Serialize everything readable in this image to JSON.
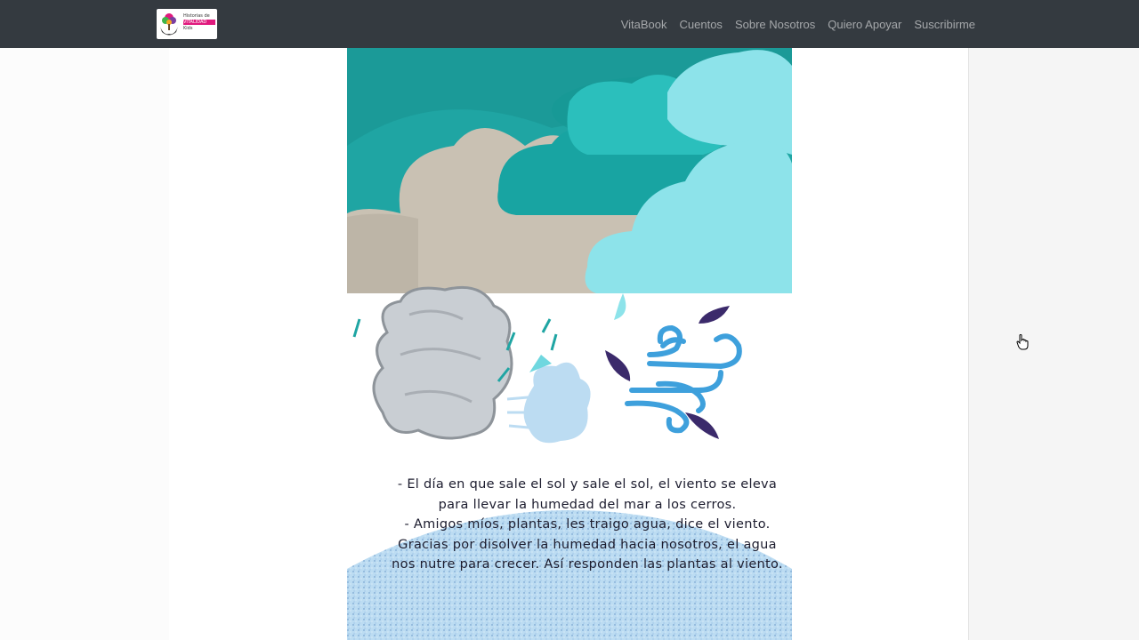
{
  "navbar": {
    "brand": {
      "logo_lines": [
        "Historias de",
        "VITALIDAD",
        "Kids"
      ],
      "logo_colors": {
        "pink": "#e0197d",
        "tree": [
          "#e0197d",
          "#3fb54a",
          "#7b3fa0",
          "#f5a623"
        ]
      }
    },
    "links": [
      "VitaBook",
      "Cuentos",
      "Sobre Nosotros",
      "Quiero Apoyar",
      "Suscribirme"
    ]
  },
  "story": {
    "lines": [
      "- El día en que sale el sol y sale el sol, el viento se eleva para llevar la humedad del mar a los cerros.",
      "- Amigos míos, plantas, les traigo agua, dice el viento.",
      "Gracias por disolver la humedad hacia nosotros, el agua nos nutre para crecer. Así responden las plantas al viento."
    ]
  },
  "illustration": {
    "icons": [
      "storm-clouds-icon",
      "blowing-cloud-icon",
      "wind-leaves-icon",
      "water-sphere-icon"
    ],
    "colors": {
      "teal": "#1fa5a3",
      "teal_dark": "#168d8b",
      "cloud_gray": "#c9c1b3",
      "cloud_light": "#8de3ea",
      "wind_blue": "#3ea0dc",
      "leaf_purple": "#3b2a6b",
      "water": "#bcdcf2"
    }
  },
  "cursor": {
    "icon": "hand-pointer-icon"
  }
}
